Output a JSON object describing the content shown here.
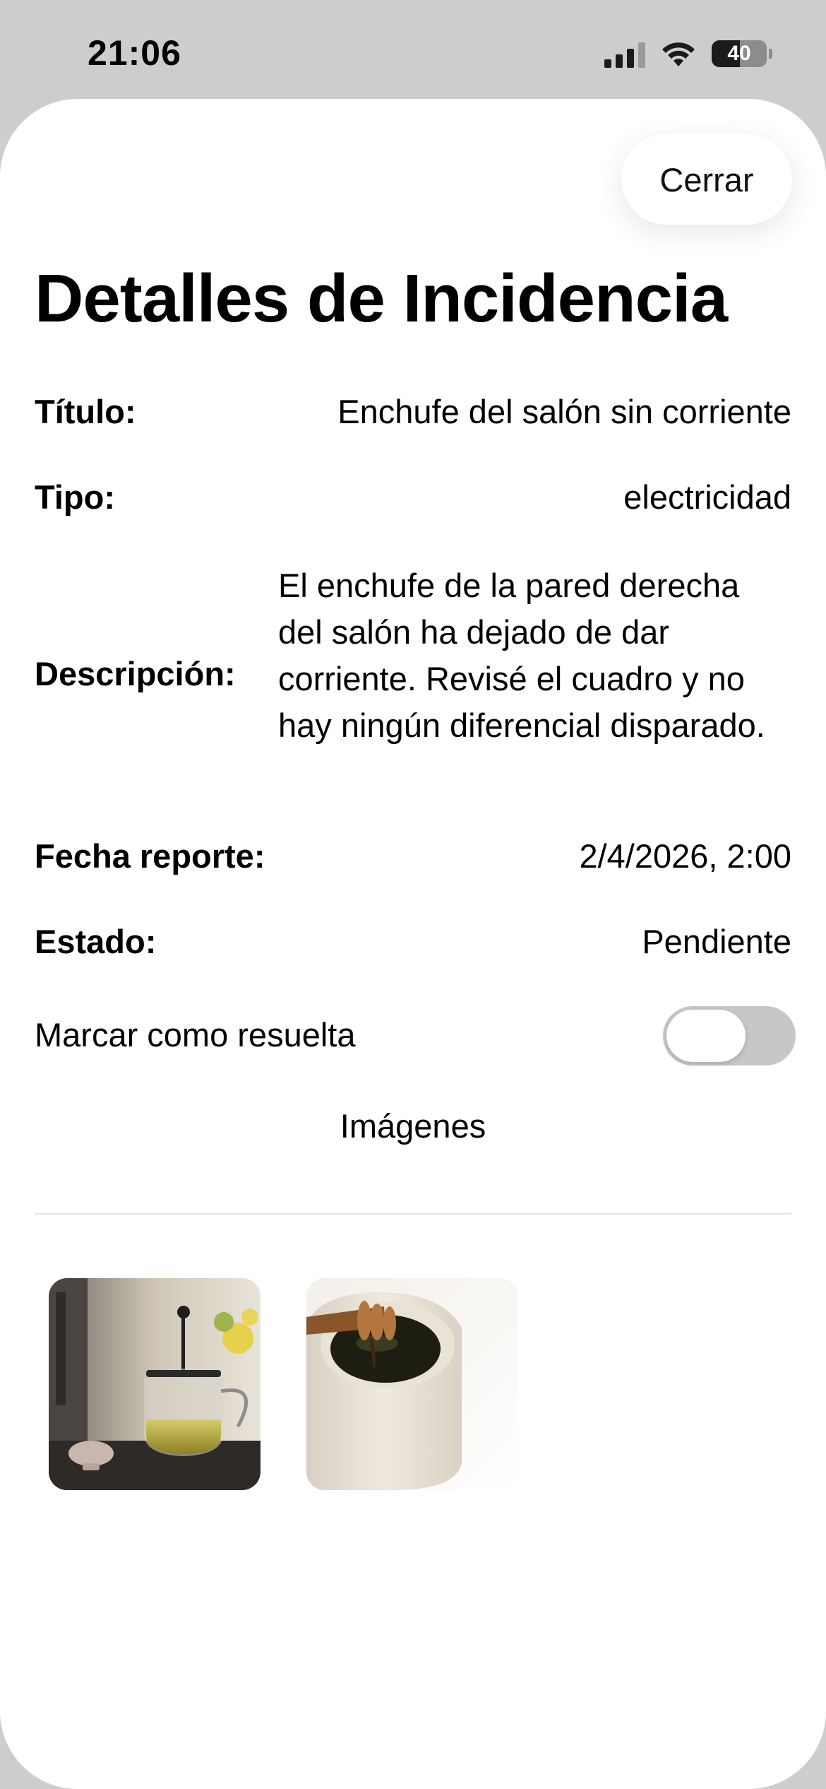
{
  "status_bar": {
    "time": "21:06",
    "battery_level": "40"
  },
  "header": {
    "close_label": "Cerrar",
    "title": "Detalles de Incidencia"
  },
  "details": {
    "title_label": "Título:",
    "title_value": "Enchufe del salón sin corriente",
    "type_label": "Tipo:",
    "type_value": "electricidad",
    "description_label": "Descripción:",
    "description_value": "El enchufe de la pared derecha del salón ha dejado de dar corriente. Revisé el cuadro y no hay ningún diferencial disparado.",
    "date_label": "Fecha reporte:",
    "date_value": "2/4/2026, 2:00",
    "state_label": "Estado:",
    "state_value": "Pendiente"
  },
  "resolve_toggle": {
    "label": "Marcar como resuelta",
    "on": false
  },
  "images": {
    "heading": "Imágenes",
    "items": [
      {
        "icon": "teapot-photo"
      },
      {
        "icon": "honey-jar-photo"
      }
    ]
  },
  "colors": {
    "background": "#cdcdcd",
    "sheet": "#ffffff",
    "toggle_off": "#c7c7c7"
  }
}
